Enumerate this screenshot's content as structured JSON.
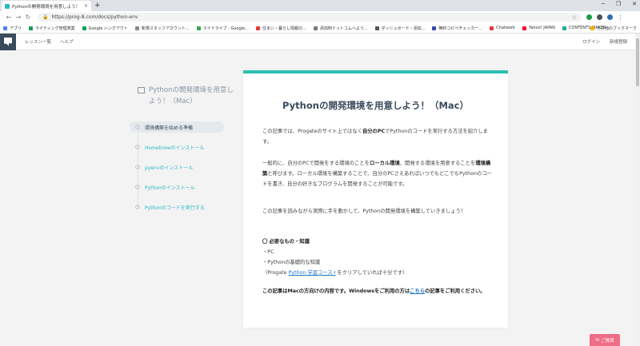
{
  "browser": {
    "tab_title": "Pythonの開発環境を用意しよう！",
    "tab_close": "×",
    "new_tab": "+",
    "url": "https://prog-8.com/docs/python-env",
    "bookmarks": [
      {
        "label": "アプリ",
        "color": "#4285f4"
      },
      {
        "label": "ライティング管理表案",
        "color": "#0f9d58"
      },
      {
        "label": "Google ハングアウト",
        "color": "#0f9d58"
      },
      {
        "label": "新規スタッフアカウント...",
        "color": "#888888"
      },
      {
        "label": "マイドライブ - Google...",
        "color": "#34a853"
      },
      {
        "label": "住まい・暮らし情報の...",
        "color": "#e53935"
      },
      {
        "label": "添加剤ドットコムへよう...",
        "color": "#777777"
      },
      {
        "label": "ダッシュボード・添加...",
        "color": "#555555"
      },
      {
        "label": "無料コピペチェッカー...",
        "color": "#3949ab"
      },
      {
        "label": "Chatwork",
        "color": "#e53935"
      },
      {
        "label": "Yahoo! JAPAN",
        "color": "#ff0033"
      },
      {
        "label": "CONTENTS MAKER...",
        "color": "#26a69a"
      }
    ],
    "bookmark_other": "その他のブックマーク"
  },
  "header": {
    "nav": [
      "レッスン一覧",
      "ヘルプ"
    ],
    "login": "ログイン",
    "signup": "新規登録"
  },
  "toc": {
    "title": "Pythonの開発環境を用意しよう！（Mac）",
    "items": [
      {
        "num": "1",
        "label": "環境構築を始める準備"
      },
      {
        "num": "2",
        "label": "Homebrewのインストール"
      },
      {
        "num": "3",
        "label": "pyenvのインストール"
      },
      {
        "num": "4",
        "label": "Pythonのインストール"
      },
      {
        "num": "5",
        "label": "Pythonのコードを実行する"
      }
    ]
  },
  "article": {
    "title": "Pythonの開発環境を用意しよう！（Mac）",
    "p1_a": "この記事では、Progateのサイト上ではなく",
    "p1_b": "自分のPC",
    "p1_c": "でPythonのコードを実行する方法を紹介します。",
    "p2_a": "一般的に、自分のPCで開発をする環境のことを",
    "p2_b": "ローカル環境",
    "p2_c": "、開発する環境を用意することを",
    "p2_d": "環境構築",
    "p2_e": "と呼びます。ローカル環境を構築することで、自分のPCさえあればいつでもどこでもPythonのコードを書き、自分の好きなプログラムを開発することが可能です。",
    "p3": "この記事を読みながら実際に手を動かして、Pythonの開発環境を構築していきましょう！",
    "req_heading": "〇 必要なもの・知識",
    "req_items": [
      "・PC",
      "・Pythonの基礎的な知識"
    ],
    "req_note_a": "（Progate ",
    "req_note_link": "Python 学習コース Ⅰ",
    "req_note_b": " をクリアしていれば十分です）",
    "note_a": "この記事はMacの方向けの内容です。Windowsをご利用の方は",
    "note_link": "こちら",
    "note_b": "の記事をご利用ください。"
  },
  "help_button": "ご質問"
}
